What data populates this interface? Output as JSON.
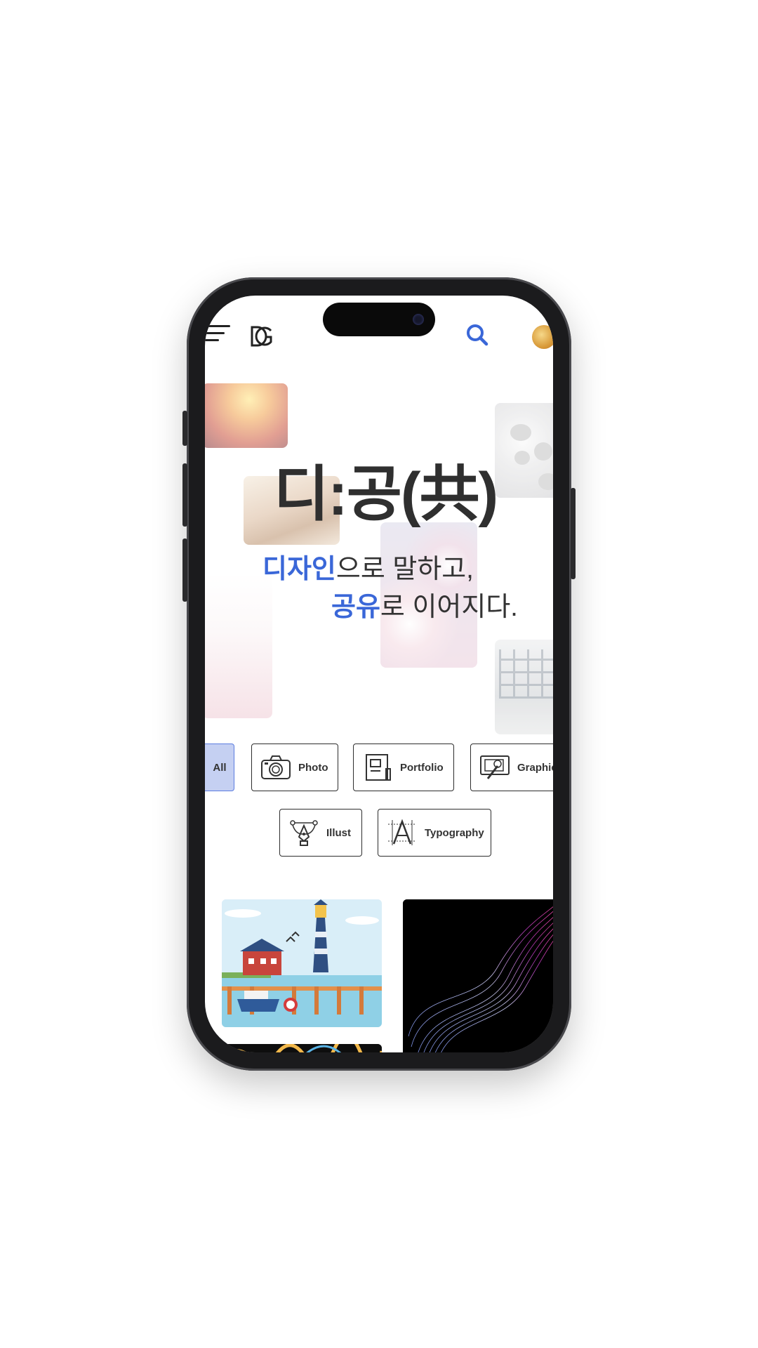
{
  "header": {
    "logo_text": "DG",
    "menu_icon": "hamburger-menu-icon",
    "search_icon": "search-icon",
    "avatar_icon": "user-avatar"
  },
  "hero": {
    "title": "디:공(共)",
    "line1_highlight": "디자인",
    "line1_rest": "으로 말하고,",
    "line2_highlight": "공유",
    "line2_rest": "로 이어지다."
  },
  "categories": [
    {
      "label": "All",
      "icon": "",
      "selected": true
    },
    {
      "label": "Photo",
      "icon": "camera-icon",
      "selected": false
    },
    {
      "label": "Portfolio",
      "icon": "portfolio-book-icon",
      "selected": false
    },
    {
      "label": "Graphic",
      "icon": "graphic-tablet-icon",
      "selected": false
    },
    {
      "label": "Illust",
      "icon": "pen-tool-icon",
      "selected": false
    },
    {
      "label": "Typography",
      "icon": "typography-icon",
      "selected": false
    }
  ],
  "colors": {
    "accent": "#3a67d8",
    "selected_bg": "#c5d0f2",
    "text": "#2f2f2f"
  }
}
